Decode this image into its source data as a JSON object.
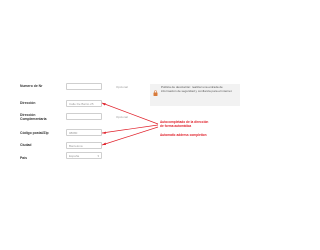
{
  "form": {
    "numero": {
      "label": "Numero de Nr",
      "value": "",
      "optional": "Opcional"
    },
    "direccion": {
      "label": "Dirección",
      "value": "Calle De Barrio 25"
    },
    "complementaria": {
      "label": "Dirección Complementaria",
      "value": "",
      "optional": "Opcional"
    },
    "postal": {
      "label": "Código postal/Zip",
      "value": "08080"
    },
    "ciudad": {
      "label": "Ciudad",
      "value": "Barcelona"
    },
    "pais": {
      "label": "País",
      "value": "España"
    }
  },
  "privacy": {
    "text": "Política de devolución: realizar una entrada de información de seguridad y confianza para el internet"
  },
  "annotations": {
    "autocomplete": "Autocompletado de la dirección de forma automática",
    "zip": "Automatic address completion"
  },
  "colors": {
    "annotation": "#e0202a",
    "lock": "#d87a3a"
  }
}
